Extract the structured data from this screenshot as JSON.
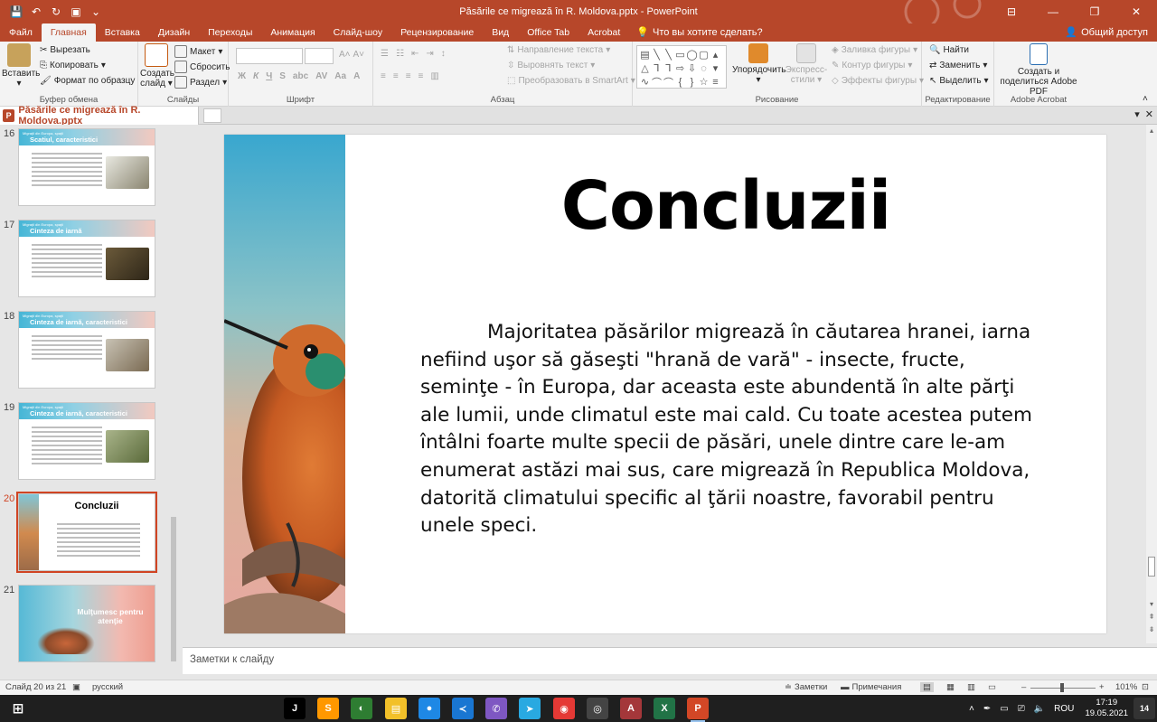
{
  "window": {
    "title": "Păsările ce migrează în R. Moldova.pptx  -  PowerPoint",
    "minimize": "—",
    "restore": "❐",
    "close": "✕",
    "ribbon_display": "⊟"
  },
  "qat": {
    "save": "💾",
    "undo": "↶",
    "redo": "↻",
    "present": "▣",
    "more": "⌄"
  },
  "tabs": [
    "Файл",
    "Главная",
    "Вставка",
    "Дизайн",
    "Переходы",
    "Анимация",
    "Слайд-шоу",
    "Рецензирование",
    "Вид",
    "Office Tab",
    "Acrobat"
  ],
  "tell_me": "Что вы хотите сделать?",
  "share": "Общий доступ",
  "ribbon": {
    "clipboard": {
      "label": "Буфер обмена",
      "paste": "Вставить",
      "cut": "Вырезать",
      "copy": "Копировать",
      "format_painter": "Формат по образцу"
    },
    "slides": {
      "label": "Слайды",
      "new_slide": "Создать слайд",
      "layout": "Макет",
      "reset": "Сбросить",
      "section": "Раздел"
    },
    "font": {
      "label": "Шрифт",
      "bold": "Ж",
      "italic": "К",
      "underline": "Ч",
      "strike": "S",
      "shadow": "abc",
      "spacing": "AV",
      "case": "Aa",
      "grow": "A˄",
      "shrink": "A˅",
      "clear": "A"
    },
    "paragraph": {
      "label": "Абзац",
      "text_direction": "Направление текста",
      "align_text": "Выровнять текст",
      "smartart": "Преобразовать в SmartArt"
    },
    "drawing": {
      "label": "Рисование",
      "arrange": "Упорядочить",
      "quick_styles": "Экспресс-стили",
      "shape_fill": "Заливка фигуры",
      "shape_outline": "Контур фигуры",
      "shape_effects": "Эффекты фигуры"
    },
    "editing": {
      "label": "Редактирование",
      "find": "Найти",
      "replace": "Заменить",
      "select": "Выделить"
    },
    "acrobat": {
      "label": "Adobe Acrobat",
      "create_share": "Создать и поделиться Adobe PDF"
    }
  },
  "doc_tab": {
    "badge": "P",
    "name": "Păsările ce migrează în R. Moldova.pptx"
  },
  "thumbnails": [
    {
      "num": "16",
      "small": "Migraţii din Europa, spaţii",
      "title": "Scatiul, caracteristici"
    },
    {
      "num": "17",
      "small": "Migraţii din Europa, spaţii",
      "title": "Cinteza de iarnă"
    },
    {
      "num": "18",
      "small": "Migraţii din Europa, spaţii",
      "title": "Cinteza de iarnă, caracteristici"
    },
    {
      "num": "19",
      "small": "Migraţii din Europa, spaţii",
      "title": "Cinteza de iarnă, caracteristici"
    },
    {
      "num": "20",
      "title": "Concluzii"
    },
    {
      "num": "21",
      "title": "Mulţumesc pentru atenţie"
    }
  ],
  "slide": {
    "title": "Concluzii",
    "body": "Majoritatea păsărilor migrează în căutarea hranei, iarna nefiind uşor să găseşti \"hrană de vară\" - insecte, fructe, seminţe - în Europa, dar aceasta este abundentă în alte părţi ale lumii, unde climatul este mai cald. Cu toate acestea putem întâlni foarte multe specii de păsări, unele dintre care le-am enumerat astăzi mai sus, care migrează în Republica Moldova, datorită climatului specific al ţării noastre, favorabil pentru unele speci."
  },
  "notes_placeholder": "Заметки к слайду",
  "status": {
    "slide_info": "Слайд 20 из 21",
    "language": "русский",
    "notes": "Заметки",
    "comments": "Примечания",
    "zoom": "101%"
  },
  "taskbar": {
    "apps": [
      {
        "name": "jetbrains",
        "glyph": "J",
        "color": "#000000"
      },
      {
        "name": "sublime",
        "glyph": "S",
        "color": "#ff9800"
      },
      {
        "name": "app-green",
        "glyph": "◐",
        "color": "#2e7d32"
      },
      {
        "name": "explorer",
        "glyph": "▤",
        "color": "#f2c029"
      },
      {
        "name": "app-round",
        "glyph": "●",
        "color": "#1e88e5"
      },
      {
        "name": "vscode",
        "glyph": "≺",
        "color": "#1976d2"
      },
      {
        "name": "viber",
        "glyph": "✆",
        "color": "#7e57c2"
      },
      {
        "name": "telegram",
        "glyph": "➤",
        "color": "#29a9e1"
      },
      {
        "name": "chrome",
        "glyph": "◉",
        "color": "#e53935"
      },
      {
        "name": "app-dark",
        "glyph": "◎",
        "color": "#444444"
      },
      {
        "name": "access",
        "glyph": "A",
        "color": "#a4373a"
      },
      {
        "name": "excel",
        "glyph": "X",
        "color": "#217346"
      },
      {
        "name": "powerpoint",
        "glyph": "P",
        "color": "#d24726"
      }
    ],
    "lang": "ROU",
    "time": "17:19",
    "date": "19.05.2021",
    "notifications": "14"
  }
}
